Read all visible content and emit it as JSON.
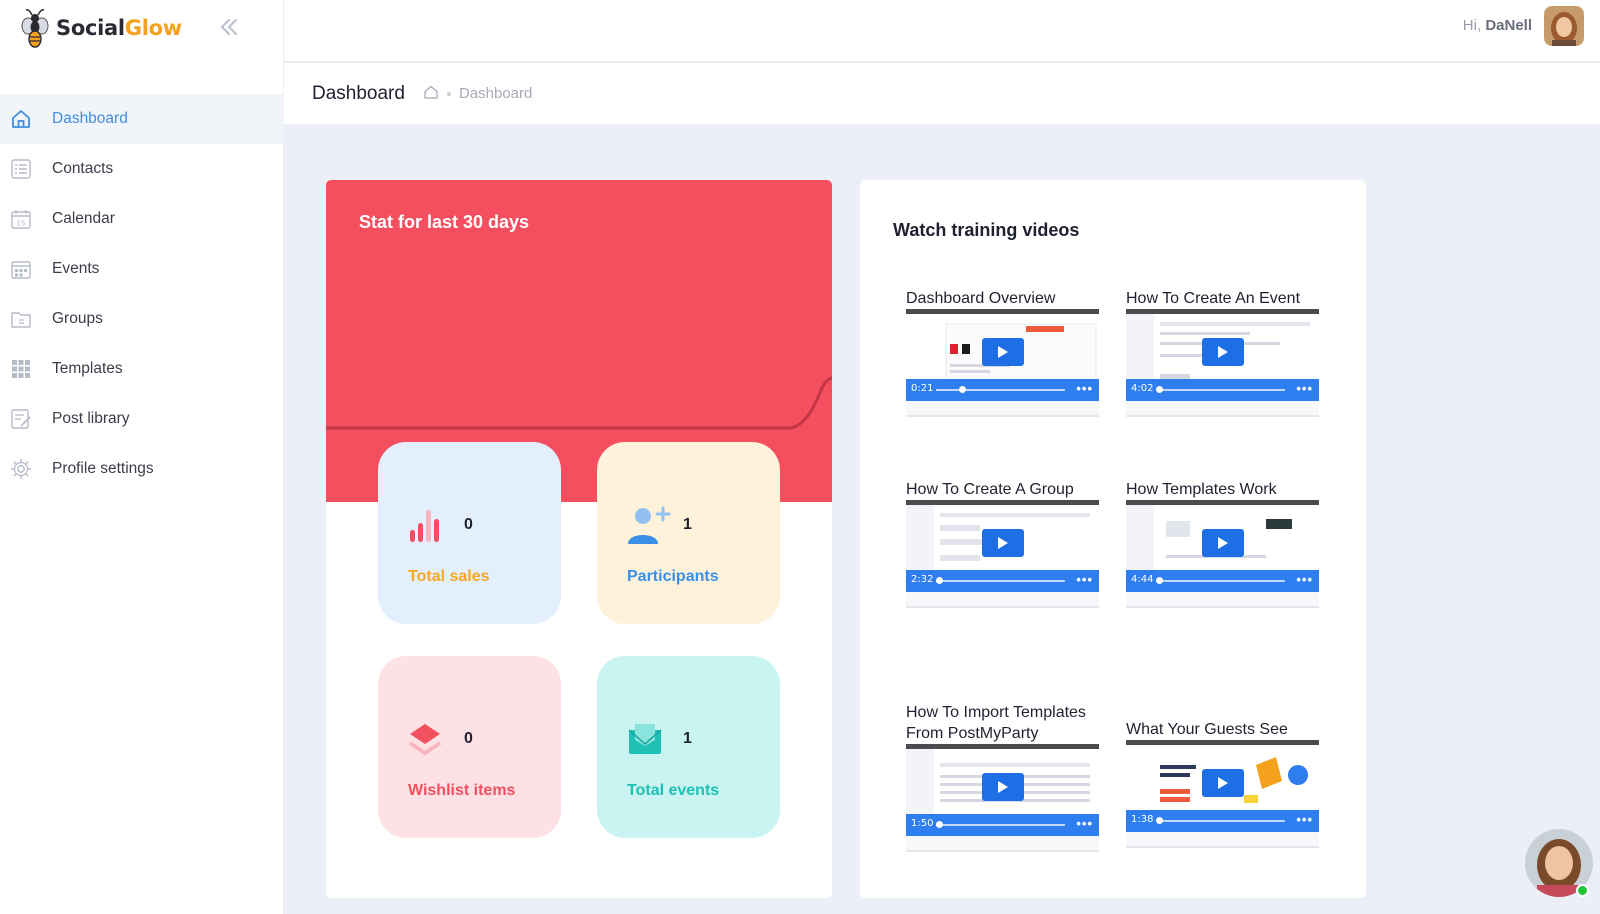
{
  "brand": {
    "name_part1": "Social",
    "name_part2": "Glow",
    "accent": "#f4a21d"
  },
  "topbar": {
    "greeting_prefix": "Hi,",
    "user_name": "DaNell"
  },
  "sidebar": {
    "items": [
      {
        "label": "Dashboard",
        "icon": "home-icon",
        "active": true
      },
      {
        "label": "Contacts",
        "icon": "contacts-icon"
      },
      {
        "label": "Calendar",
        "icon": "calendar-icon"
      },
      {
        "label": "Events",
        "icon": "events-icon"
      },
      {
        "label": "Groups",
        "icon": "groups-icon"
      },
      {
        "label": "Templates",
        "icon": "templates-grid-icon"
      },
      {
        "label": "Post library",
        "icon": "post-library-icon"
      },
      {
        "label": "Profile settings",
        "icon": "gear-icon"
      }
    ]
  },
  "page": {
    "title": "Dashboard",
    "breadcrumb": "Dashboard"
  },
  "stats": {
    "title": "Stat for last 30 days",
    "hero_color": "#f54f5f",
    "tiles": [
      {
        "label": "Total sales",
        "value": "0",
        "icon": "bar-chart-icon",
        "bg": "#e3effd",
        "label_color": "#f6a821"
      },
      {
        "label": "Participants",
        "value": "1",
        "icon": "add-user-icon",
        "bg": "#fef2db",
        "label_color": "#3a8fe6"
      },
      {
        "label": "Wishlist items",
        "value": "0",
        "icon": "layers-icon",
        "bg": "#fde1e4",
        "label_color": "#f2505f"
      },
      {
        "label": "Total events",
        "value": "1",
        "icon": "envelope-icon",
        "bg": "#c9f4f1",
        "label_color": "#1ec1b4"
      }
    ]
  },
  "videos": {
    "title": "Watch training videos",
    "items": [
      {
        "title": "Dashboard Overview",
        "duration": "0:21",
        "progress": 0.2
      },
      {
        "title": "How To Create An Event",
        "duration": "4:02",
        "progress": 0.02
      },
      {
        "title": "How To Create A Group",
        "duration": "2:32",
        "progress": 0.02
      },
      {
        "title": "How Templates Work",
        "duration": "4:44",
        "progress": 0.02
      },
      {
        "title": "How To Import Templates From PostMyParty",
        "duration": "1:50",
        "progress": 0.02
      },
      {
        "title": "What Your Guests See",
        "duration": "1:38",
        "progress": 0.02
      }
    ]
  }
}
